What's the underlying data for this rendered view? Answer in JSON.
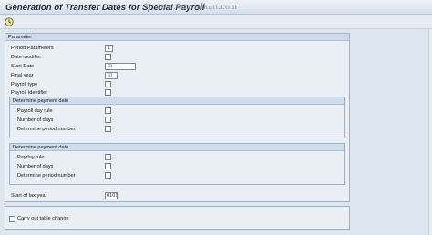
{
  "title": "Generation of Transfer Dates for Special Payroll",
  "watermark": "© www.tutorialkart.com",
  "toolbar": {
    "execute_icon": "execute-clock-icon"
  },
  "parameter": {
    "header": "Parameter",
    "period_parameters": {
      "label": "Period Parameters",
      "value": "1"
    },
    "date_modifier": {
      "label": "Date modifier",
      "value": ""
    },
    "start_date": {
      "label": "Start Date",
      "value": "☑"
    },
    "final_year": {
      "label": "Final year",
      "value": "☑"
    },
    "payroll_type": {
      "label": "Payroll type",
      "value": ""
    },
    "payroll_identifier": {
      "label": "Payroll Identifier",
      "value": ""
    },
    "group1": {
      "header": "Determine payment date",
      "payroll_day_rule": {
        "label": "Payroll day rule",
        "value": ""
      },
      "number_of_days": {
        "label": "Number of days",
        "value": ""
      },
      "determine_period_number": {
        "label": "Determine period number",
        "value": ""
      }
    },
    "group2": {
      "header": "Determine payment date",
      "payday_rule": {
        "label": "Payday rule",
        "value": ""
      },
      "number_of_days": {
        "label": "Number of days",
        "value": ""
      },
      "determine_period_number": {
        "label": "Determine period number",
        "value": ""
      }
    },
    "start_of_tax_year": {
      "label": "Start of tax year",
      "value": "0101"
    }
  },
  "options": {
    "carry_out_table_change": {
      "label": "Carry out table change",
      "checked": false
    }
  }
}
